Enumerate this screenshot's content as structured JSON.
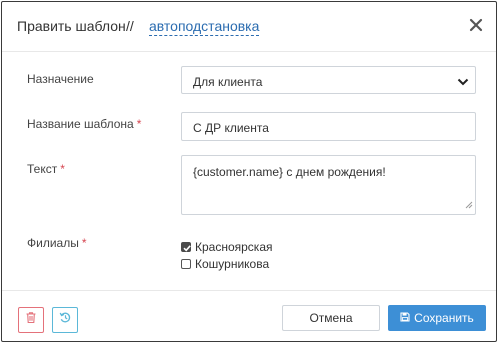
{
  "header": {
    "title": "Править шаблон",
    "separator": "//",
    "subtitle": "автоподстановка",
    "close_icon": "close-icon"
  },
  "form": {
    "purpose": {
      "label": "Назначение",
      "value": "Для клиента"
    },
    "template_name": {
      "label": "Название шаблона",
      "required": "*",
      "value": "С ДР клиента"
    },
    "text": {
      "label": "Текст",
      "required": "*",
      "value": "{customer.name} с днем рождения!"
    },
    "branches": {
      "label": "Филиалы",
      "required": "*",
      "options": [
        {
          "label": "Красноярская",
          "checked": true
        },
        {
          "label": "Кошурникова",
          "checked": false
        }
      ]
    }
  },
  "footer": {
    "delete_icon": "trash-icon",
    "reset_icon": "history-icon",
    "cancel_label": "Отмена",
    "save_label": "Сохранить",
    "save_icon": "floppy-disk-icon"
  },
  "colors": {
    "primary": "#3d8fd6",
    "link": "#2b6cb0",
    "required": "#d64550",
    "danger": "#e4717a",
    "info": "#5bb8d8"
  }
}
